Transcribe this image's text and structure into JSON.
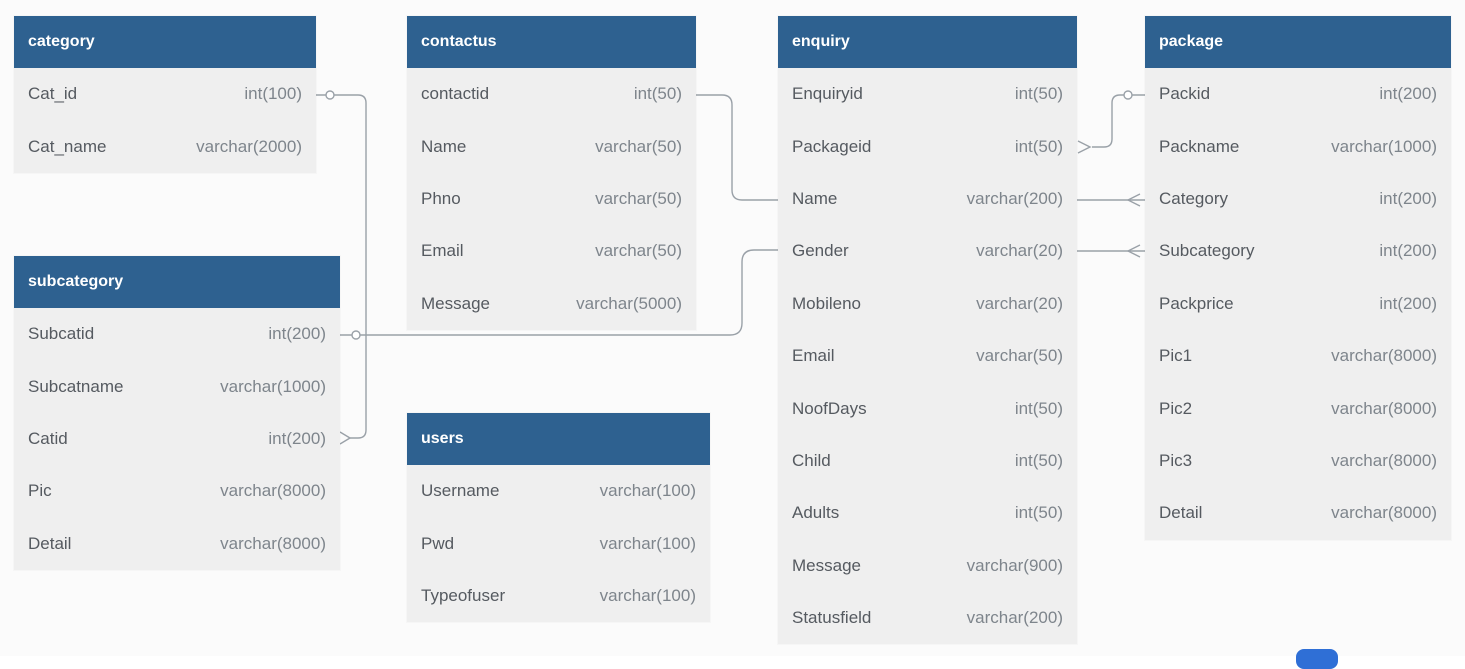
{
  "tables": {
    "category": {
      "name": "category",
      "columns": [
        {
          "name": "Cat_id",
          "type": "int(100)"
        },
        {
          "name": "Cat_name",
          "type": "varchar(2000)"
        }
      ]
    },
    "subcategory": {
      "name": "subcategory",
      "columns": [
        {
          "name": "Subcatid",
          "type": "int(200)"
        },
        {
          "name": "Subcatname",
          "type": "varchar(1000)"
        },
        {
          "name": "Catid",
          "type": "int(200)"
        },
        {
          "name": "Pic",
          "type": "varchar(8000)"
        },
        {
          "name": "Detail",
          "type": "varchar(8000)"
        }
      ]
    },
    "contactus": {
      "name": "contactus",
      "columns": [
        {
          "name": "contactid",
          "type": "int(50)"
        },
        {
          "name": "Name",
          "type": "varchar(50)"
        },
        {
          "name": "Phno",
          "type": "varchar(50)"
        },
        {
          "name": "Email",
          "type": "varchar(50)"
        },
        {
          "name": "Message",
          "type": "varchar(5000)"
        }
      ]
    },
    "users": {
      "name": "users",
      "columns": [
        {
          "name": "Username",
          "type": "varchar(100)"
        },
        {
          "name": "Pwd",
          "type": "varchar(100)"
        },
        {
          "name": "Typeofuser",
          "type": "varchar(100)"
        }
      ]
    },
    "enquiry": {
      "name": "enquiry",
      "columns": [
        {
          "name": "Enquiryid",
          "type": "int(50)"
        },
        {
          "name": "Packageid",
          "type": "int(50)"
        },
        {
          "name": "Name",
          "type": "varchar(200)"
        },
        {
          "name": "Gender",
          "type": "varchar(20)"
        },
        {
          "name": "Mobileno",
          "type": "varchar(20)"
        },
        {
          "name": "Email",
          "type": "varchar(50)"
        },
        {
          "name": "NoofDays",
          "type": "int(50)"
        },
        {
          "name": "Child",
          "type": "int(50)"
        },
        {
          "name": "Adults",
          "type": "int(50)"
        },
        {
          "name": "Message",
          "type": "varchar(900)"
        },
        {
          "name": "Statusfield",
          "type": "varchar(200)"
        }
      ]
    },
    "package": {
      "name": "package",
      "columns": [
        {
          "name": "Packid",
          "type": "int(200)"
        },
        {
          "name": "Packname",
          "type": "varchar(1000)"
        },
        {
          "name": "Category",
          "type": "int(200)"
        },
        {
          "name": "Subcategory",
          "type": "int(200)"
        },
        {
          "name": "Packprice",
          "type": "int(200)"
        },
        {
          "name": "Pic1",
          "type": "varchar(8000)"
        },
        {
          "name": "Pic2",
          "type": "varchar(8000)"
        },
        {
          "name": "Pic3",
          "type": "varchar(8000)"
        },
        {
          "name": "Detail",
          "type": "varchar(8000)"
        }
      ]
    }
  },
  "colors": {
    "header": "#2e6190",
    "body": "#efefef",
    "connector": "#9aa1a8"
  }
}
